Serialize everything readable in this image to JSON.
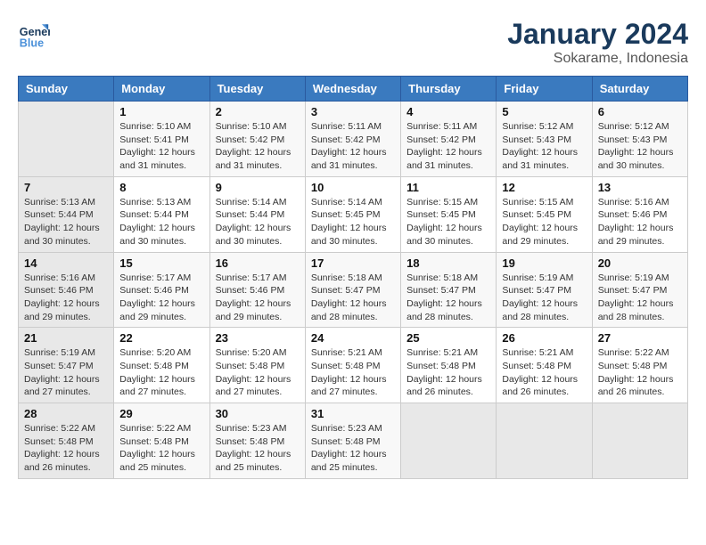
{
  "header": {
    "logo_line1": "General",
    "logo_line2": "Blue",
    "title": "January 2024",
    "subtitle": "Sokarame, Indonesia"
  },
  "weekdays": [
    "Sunday",
    "Monday",
    "Tuesday",
    "Wednesday",
    "Thursday",
    "Friday",
    "Saturday"
  ],
  "weeks": [
    [
      {
        "day": "",
        "info": ""
      },
      {
        "day": "1",
        "info": "Sunrise: 5:10 AM\nSunset: 5:41 PM\nDaylight: 12 hours\nand 31 minutes."
      },
      {
        "day": "2",
        "info": "Sunrise: 5:10 AM\nSunset: 5:42 PM\nDaylight: 12 hours\nand 31 minutes."
      },
      {
        "day": "3",
        "info": "Sunrise: 5:11 AM\nSunset: 5:42 PM\nDaylight: 12 hours\nand 31 minutes."
      },
      {
        "day": "4",
        "info": "Sunrise: 5:11 AM\nSunset: 5:42 PM\nDaylight: 12 hours\nand 31 minutes."
      },
      {
        "day": "5",
        "info": "Sunrise: 5:12 AM\nSunset: 5:43 PM\nDaylight: 12 hours\nand 31 minutes."
      },
      {
        "day": "6",
        "info": "Sunrise: 5:12 AM\nSunset: 5:43 PM\nDaylight: 12 hours\nand 30 minutes."
      }
    ],
    [
      {
        "day": "7",
        "info": "Sunrise: 5:13 AM\nSunset: 5:44 PM\nDaylight: 12 hours\nand 30 minutes."
      },
      {
        "day": "8",
        "info": "Sunrise: 5:13 AM\nSunset: 5:44 PM\nDaylight: 12 hours\nand 30 minutes."
      },
      {
        "day": "9",
        "info": "Sunrise: 5:14 AM\nSunset: 5:44 PM\nDaylight: 12 hours\nand 30 minutes."
      },
      {
        "day": "10",
        "info": "Sunrise: 5:14 AM\nSunset: 5:45 PM\nDaylight: 12 hours\nand 30 minutes."
      },
      {
        "day": "11",
        "info": "Sunrise: 5:15 AM\nSunset: 5:45 PM\nDaylight: 12 hours\nand 30 minutes."
      },
      {
        "day": "12",
        "info": "Sunrise: 5:15 AM\nSunset: 5:45 PM\nDaylight: 12 hours\nand 29 minutes."
      },
      {
        "day": "13",
        "info": "Sunrise: 5:16 AM\nSunset: 5:46 PM\nDaylight: 12 hours\nand 29 minutes."
      }
    ],
    [
      {
        "day": "14",
        "info": "Sunrise: 5:16 AM\nSunset: 5:46 PM\nDaylight: 12 hours\nand 29 minutes."
      },
      {
        "day": "15",
        "info": "Sunrise: 5:17 AM\nSunset: 5:46 PM\nDaylight: 12 hours\nand 29 minutes."
      },
      {
        "day": "16",
        "info": "Sunrise: 5:17 AM\nSunset: 5:46 PM\nDaylight: 12 hours\nand 29 minutes."
      },
      {
        "day": "17",
        "info": "Sunrise: 5:18 AM\nSunset: 5:47 PM\nDaylight: 12 hours\nand 28 minutes."
      },
      {
        "day": "18",
        "info": "Sunrise: 5:18 AM\nSunset: 5:47 PM\nDaylight: 12 hours\nand 28 minutes."
      },
      {
        "day": "19",
        "info": "Sunrise: 5:19 AM\nSunset: 5:47 PM\nDaylight: 12 hours\nand 28 minutes."
      },
      {
        "day": "20",
        "info": "Sunrise: 5:19 AM\nSunset: 5:47 PM\nDaylight: 12 hours\nand 28 minutes."
      }
    ],
    [
      {
        "day": "21",
        "info": "Sunrise: 5:19 AM\nSunset: 5:47 PM\nDaylight: 12 hours\nand 27 minutes."
      },
      {
        "day": "22",
        "info": "Sunrise: 5:20 AM\nSunset: 5:48 PM\nDaylight: 12 hours\nand 27 minutes."
      },
      {
        "day": "23",
        "info": "Sunrise: 5:20 AM\nSunset: 5:48 PM\nDaylight: 12 hours\nand 27 minutes."
      },
      {
        "day": "24",
        "info": "Sunrise: 5:21 AM\nSunset: 5:48 PM\nDaylight: 12 hours\nand 27 minutes."
      },
      {
        "day": "25",
        "info": "Sunrise: 5:21 AM\nSunset: 5:48 PM\nDaylight: 12 hours\nand 26 minutes."
      },
      {
        "day": "26",
        "info": "Sunrise: 5:21 AM\nSunset: 5:48 PM\nDaylight: 12 hours\nand 26 minutes."
      },
      {
        "day": "27",
        "info": "Sunrise: 5:22 AM\nSunset: 5:48 PM\nDaylight: 12 hours\nand 26 minutes."
      }
    ],
    [
      {
        "day": "28",
        "info": "Sunrise: 5:22 AM\nSunset: 5:48 PM\nDaylight: 12 hours\nand 26 minutes."
      },
      {
        "day": "29",
        "info": "Sunrise: 5:22 AM\nSunset: 5:48 PM\nDaylight: 12 hours\nand 25 minutes."
      },
      {
        "day": "30",
        "info": "Sunrise: 5:23 AM\nSunset: 5:48 PM\nDaylight: 12 hours\nand 25 minutes."
      },
      {
        "day": "31",
        "info": "Sunrise: 5:23 AM\nSunset: 5:48 PM\nDaylight: 12 hours\nand 25 minutes."
      },
      {
        "day": "",
        "info": ""
      },
      {
        "day": "",
        "info": ""
      },
      {
        "day": "",
        "info": ""
      }
    ]
  ]
}
